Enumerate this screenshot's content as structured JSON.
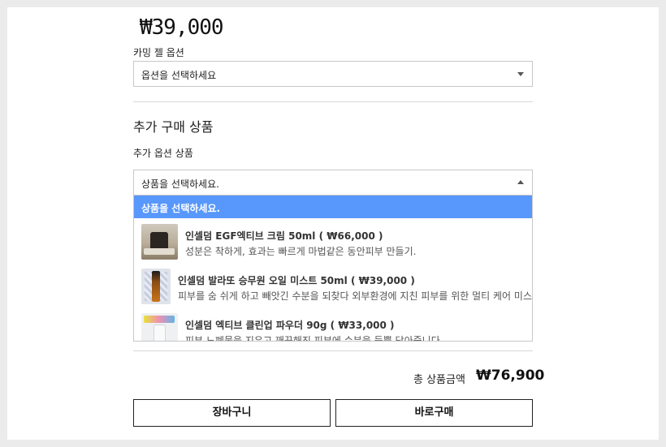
{
  "product": {
    "price": "₩39,000"
  },
  "option": {
    "label": "카밍 젤 옵션",
    "select_value": "옵션을 선택하세요"
  },
  "additional": {
    "section_title": "추가 구매 상품",
    "label": "추가 옵션 상품",
    "select_value": "상품을 선택하세요.",
    "dropdown_header": "상품을 선택하세요.",
    "items": [
      {
        "title": "인셀덤 EGF엑티브 크림 50ml ( ₩66,000 )",
        "desc": "성분은 착하게, 효과는 빠르게 마법같은 동안피부 만들기."
      },
      {
        "title": "인셀덤 발라또 승무원 오일 미스트 50ml ( ₩39,000 )",
        "desc": "피부를 숨 쉬게 하고 빼앗긴 수분을 되찾다 외부환경에 지친 피부를 위한 멀티 케어 미스트"
      },
      {
        "title": "인셀덤 엑티브 클린업 파우더 90g ( ₩33,000 )",
        "desc": "피부 노폐물을 지우고 깨끗해진 피부에 수분을 듬뿍 담아줍니다"
      }
    ]
  },
  "summary": {
    "total_label": "총 상품금액",
    "total_value": "₩76,900"
  },
  "actions": {
    "cart_label": "장바구니",
    "buy_label": "바로구매"
  },
  "colors": {
    "dropdown_highlight": "#5897fb",
    "page_background": "#ebebeb"
  },
  "icons": {
    "select_arrow_closed": "triangle-down",
    "select_arrow_open": "triangle-up"
  }
}
